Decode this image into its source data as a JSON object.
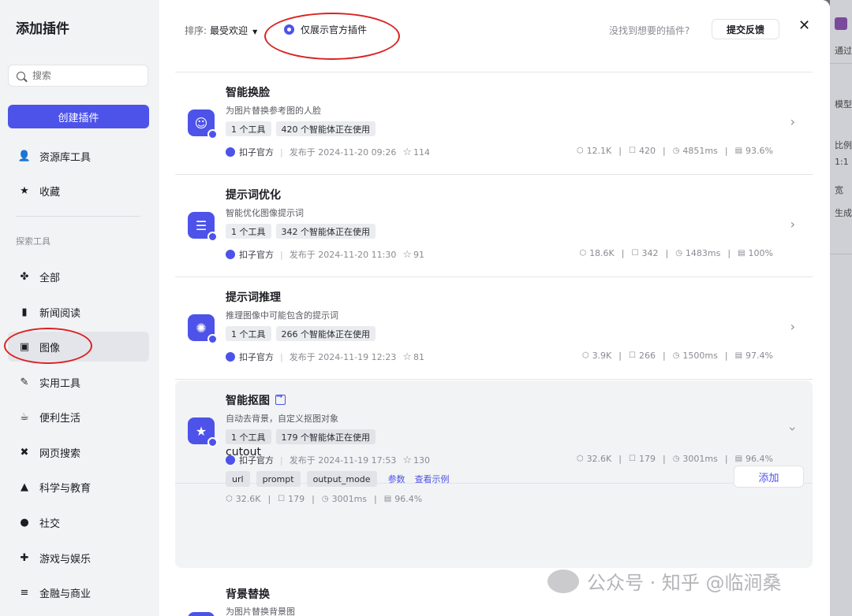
{
  "sidebar": {
    "title": "添加插件",
    "search_placeholder": "搜索",
    "create_label": "创建插件",
    "top_items": [
      {
        "label": "资源库工具",
        "icon": "person-icon"
      },
      {
        "label": "收藏",
        "icon": "star-icon"
      }
    ],
    "section_label": "探索工具",
    "items": [
      {
        "label": "全部",
        "icon": "grid-icon"
      },
      {
        "label": "新闻阅读",
        "icon": "book-icon"
      },
      {
        "label": "图像",
        "icon": "image-icon"
      },
      {
        "label": "实用工具",
        "icon": "wrench-icon"
      },
      {
        "label": "便利生活",
        "icon": "cup-icon"
      },
      {
        "label": "网页搜索",
        "icon": "web-icon"
      },
      {
        "label": "科学与教育",
        "icon": "graduation-cap-icon"
      },
      {
        "label": "社交",
        "icon": "chat-icon"
      },
      {
        "label": "游戏与娱乐",
        "icon": "gamepad-icon"
      },
      {
        "label": "金融与商业",
        "icon": "database-icon"
      }
    ],
    "active_index": 2
  },
  "header": {
    "sort_label": "排序:",
    "sort_value": "最受欢迎",
    "official_only": "仅展示官方插件",
    "not_found": "没找到想要的插件?",
    "feedback": "提交反馈",
    "close": "✕"
  },
  "plugins": [
    {
      "name": "智能换脸",
      "desc": "为图片替换参考图的人脸",
      "tools": "1 个工具",
      "agents": "420 个智能体正在使用",
      "publisher": "扣子官方",
      "published": "发布于 2024-11-20 09:26",
      "stars": "114",
      "calls": "12.1K",
      "bots": "420",
      "latency": "4851ms",
      "success": "93.6%"
    },
    {
      "name": "提示词优化",
      "desc": "智能优化图像提示词",
      "tools": "1 个工具",
      "agents": "342 个智能体正在使用",
      "publisher": "扣子官方",
      "published": "发布于 2024-11-20 11:30",
      "stars": "91",
      "calls": "18.6K",
      "bots": "342",
      "latency": "1483ms",
      "success": "100%"
    },
    {
      "name": "提示词推理",
      "desc": "推理图像中可能包含的提示词",
      "tools": "1 个工具",
      "agents": "266 个智能体正在使用",
      "publisher": "扣子官方",
      "published": "发布于 2024-11-19 12:23",
      "stars": "81",
      "calls": "3.9K",
      "bots": "266",
      "latency": "1500ms",
      "success": "97.4%"
    },
    {
      "name": "智能抠图",
      "desc": "自动去背景，自定义抠图对象",
      "tools": "1 个工具",
      "agents": "179 个智能体正在使用",
      "publisher": "扣子官方",
      "published": "发布于 2024-11-19 17:53",
      "stars": "130",
      "calls": "32.6K",
      "bots": "179",
      "latency": "3001ms",
      "success": "96.4%"
    },
    {
      "name": "背景替换",
      "desc": "为图片替换背景图"
    }
  ],
  "expanded_tool": {
    "name": "cutout",
    "params": [
      "url",
      "prompt",
      "output_mode"
    ],
    "params_link": "参数",
    "example_link": "查看示例",
    "add": "添加",
    "calls": "32.6K",
    "bots": "179",
    "latency": "3001ms",
    "success": "96.4%"
  },
  "watermark": "公众号 · 知乎 @临涧桑",
  "background_panel": [
    "通过",
    "模型",
    "比例",
    "1:1",
    "宽",
    "生成"
  ],
  "colors": {
    "accent": "#4d53e8",
    "annotation": "#d92323",
    "sidebar_bg": "#f2f3f5"
  }
}
